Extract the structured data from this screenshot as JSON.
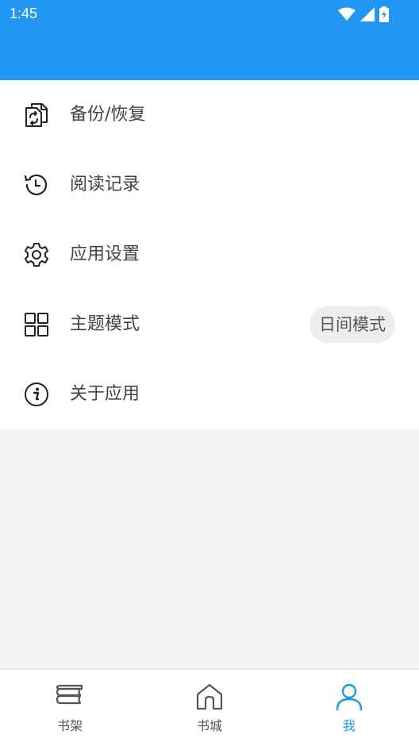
{
  "status_bar": {
    "time": "1:45",
    "icons": [
      "wifi-icon",
      "signal-icon",
      "battery-charging-icon"
    ]
  },
  "colors": {
    "primary": "#2196f3",
    "active_nav": "#1a9ae0",
    "text": "#444444",
    "background": "#f3f3f3"
  },
  "menu": {
    "items": [
      {
        "label": "备份/恢复",
        "icon": "backup-restore-icon"
      },
      {
        "label": "阅读记录",
        "icon": "history-icon"
      },
      {
        "label": "应用设置",
        "icon": "gear-icon"
      },
      {
        "label": "主题模式",
        "icon": "grid-icon",
        "value": "日间模式"
      },
      {
        "label": "关于应用",
        "icon": "info-icon"
      }
    ]
  },
  "bottom_nav": {
    "items": [
      {
        "label": "书架",
        "icon": "bookshelf-icon",
        "active": false
      },
      {
        "label": "书城",
        "icon": "home-icon",
        "active": false
      },
      {
        "label": "我",
        "icon": "person-icon",
        "active": true
      }
    ]
  }
}
